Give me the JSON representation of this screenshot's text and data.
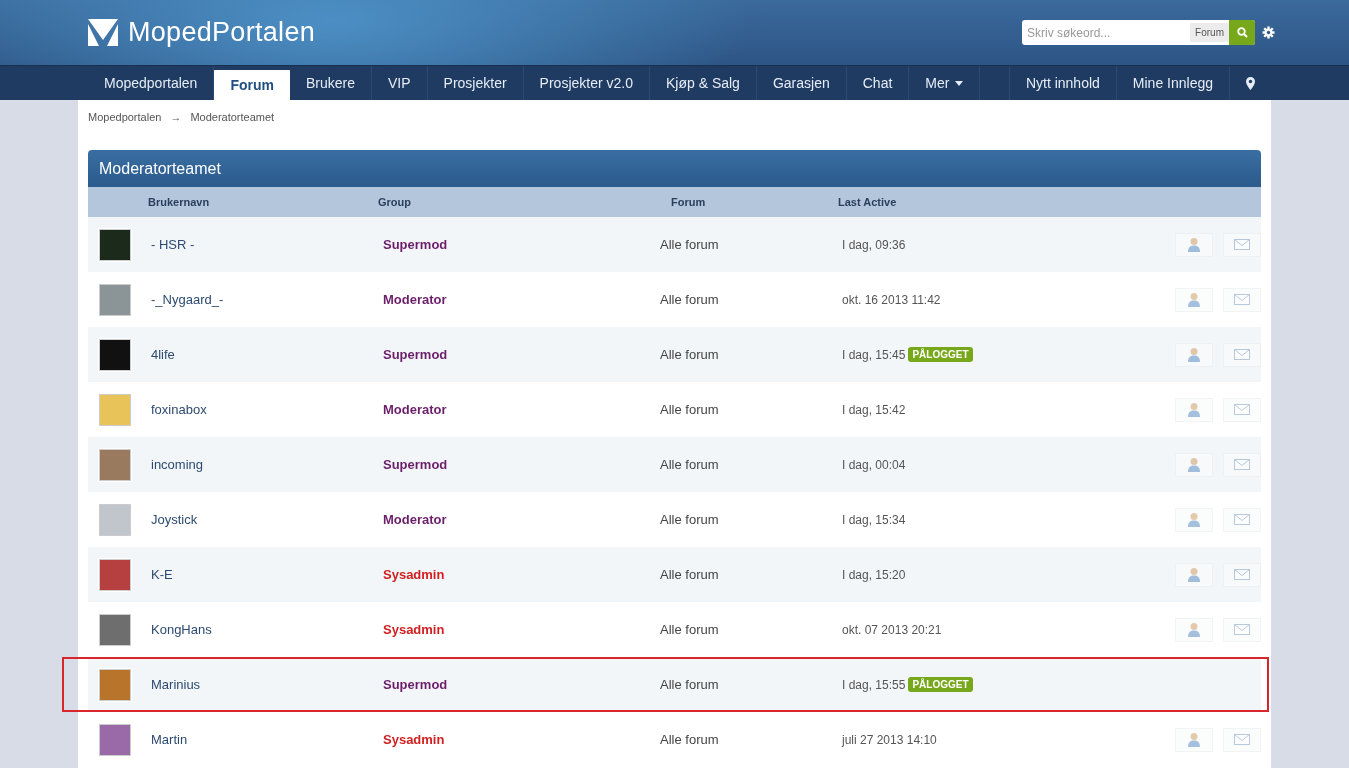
{
  "site": {
    "title": "MopedPortalen"
  },
  "search": {
    "placeholder": "Skriv søkeord...",
    "scope": "Forum"
  },
  "nav": [
    {
      "label": "Mopedportalen",
      "selected": false
    },
    {
      "label": "Forum",
      "selected": true
    },
    {
      "label": "Brukere",
      "selected": false
    },
    {
      "label": "VIP",
      "selected": false
    },
    {
      "label": "Prosjekter",
      "selected": false
    },
    {
      "label": "Prosjekter v2.0",
      "selected": false
    },
    {
      "label": "Kjøp & Salg",
      "selected": false
    },
    {
      "label": "Garasjen",
      "selected": false
    },
    {
      "label": "Chat",
      "selected": false
    },
    {
      "label": "Mer",
      "selected": false
    }
  ],
  "nav_right": [
    "Nytt innhold",
    "Mine Innlegg"
  ],
  "breadcrumb": {
    "items": [
      "Mopedportalen",
      "Moderatorteamet"
    ],
    "separator": "→"
  },
  "table": {
    "title": "Moderatorteamet",
    "columns": [
      "Brukernavn",
      "Group",
      "Forum",
      "Last Active"
    ],
    "rows": [
      {
        "name": "- HSR -",
        "group": "Supermod",
        "color": "#6b1f6b",
        "forum": "Alle forum",
        "last_active": "I dag, 09:36",
        "actions": true,
        "highlighted": false
      },
      {
        "name": "-_Nygaard_-",
        "group": "Moderator",
        "color": "#6b1f6b",
        "forum": "Alle forum",
        "last_active": "okt. 16 2013 11:42",
        "actions": true,
        "highlighted": false
      },
      {
        "name": "4life",
        "group": "Supermod",
        "color": "#6b1f6b",
        "forum": "Alle forum",
        "last_active": "I dag, 15:45",
        "badge": "PÅLOGGET",
        "actions": true,
        "highlighted": false
      },
      {
        "name": "foxinabox",
        "group": "Moderator",
        "color": "#6b1f6b",
        "forum": "Alle forum",
        "last_active": "I dag, 15:42",
        "actions": true,
        "highlighted": false
      },
      {
        "name": "incoming",
        "group": "Supermod",
        "color": "#6b1f6b",
        "forum": "Alle forum",
        "last_active": "I dag, 00:04",
        "actions": true,
        "highlighted": false
      },
      {
        "name": "Joystick",
        "group": "Moderator",
        "color": "#6b1f6b",
        "forum": "Alle forum",
        "last_active": "I dag, 15:34",
        "actions": true,
        "highlighted": false
      },
      {
        "name": "K-E",
        "group": "Sysadmin",
        "color": "#d21f1f",
        "forum": "Alle forum",
        "last_active": "I dag, 15:20",
        "actions": true,
        "highlighted": false
      },
      {
        "name": "KongHans",
        "group": "Sysadmin",
        "color": "#d21f1f",
        "forum": "Alle forum",
        "last_active": "okt. 07 2013 20:21",
        "actions": true,
        "highlighted": false
      },
      {
        "name": "Marinius",
        "group": "Supermod",
        "color": "#6b1f6b",
        "forum": "Alle forum",
        "last_active": "I dag, 15:55",
        "badge": "PÅLOGGET",
        "actions": false,
        "highlighted": true
      },
      {
        "name": "Martin",
        "group": "Sysadmin",
        "color": "#d21f1f",
        "forum": "Alle forum",
        "last_active": "juli 27 2013 14:10",
        "actions": true,
        "highlighted": false
      }
    ]
  }
}
